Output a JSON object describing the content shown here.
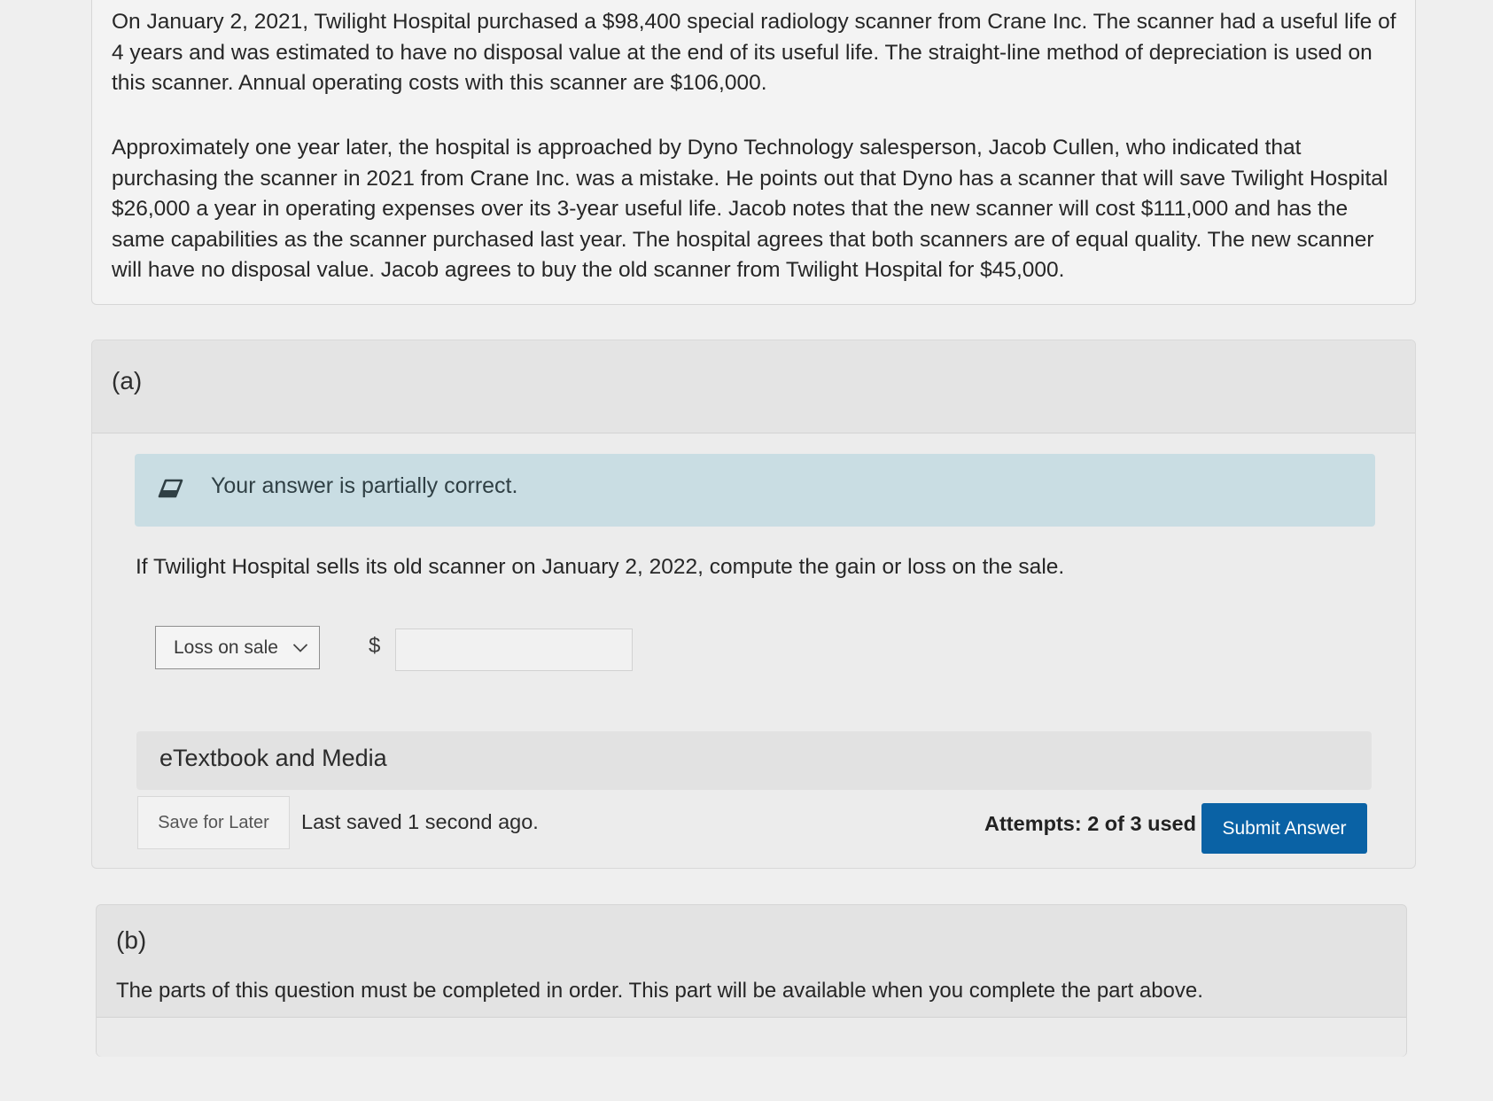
{
  "problem": {
    "paragraph1": "On January 2, 2021, Twilight Hospital purchased a $98,400 special radiology scanner from Crane Inc. The scanner had a useful life of 4 years and was estimated to have no disposal value at the end of its useful life. The straight-line method of depreciation is used on this scanner. Annual operating costs with this scanner are $106,000.",
    "paragraph2": "Approximately one year later, the hospital is approached by Dyno Technology salesperson, Jacob Cullen, who indicated that purchasing the scanner in 2021 from Crane Inc. was a mistake. He points out that Dyno has a scanner that will save Twilight Hospital $26,000 a year in operating expenses over its 3-year useful life. Jacob notes that the new scanner will cost $111,000 and has the same capabilities as the scanner purchased last year. The hospital agrees that both scanners are of equal quality. The new scanner will have no disposal value. Jacob agrees to buy the old scanner from Twilight Hospital for $45,000."
  },
  "part_a": {
    "label": "(a)",
    "feedback": {
      "icon": "eraser-icon",
      "text": "Your answer is partially correct."
    },
    "question": "If Twilight Hospital sells its old scanner on January 2, 2022, compute the gain or loss on the sale.",
    "select": {
      "value": "Loss on sale"
    },
    "currency_symbol": "$",
    "amount": {
      "value": "",
      "placeholder": ""
    },
    "etextbook_label": "eTextbook and Media",
    "save_for_later_label": "Save for Later",
    "last_saved": "Last saved 1 second ago.",
    "attempts": "Attempts: 2 of 3 used",
    "submit_label": "Submit Answer",
    "colors": {
      "feedback_bg": "#c9dde3",
      "submit_bg": "#0a62a5"
    }
  },
  "part_b": {
    "label": "(b)",
    "message": "The parts of this question must be completed in order. This part will be available when you complete the part above."
  }
}
